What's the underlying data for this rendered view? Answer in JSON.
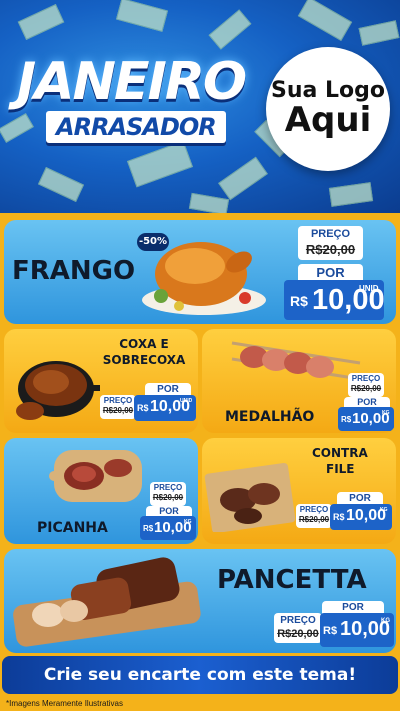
{
  "hero": {
    "title": "JANEIRO",
    "subtitle": "ARRASADOR",
    "logo_line1": "Sua Logo",
    "logo_line2": "Aqui"
  },
  "products": [
    {
      "name": "FRANGO",
      "discount": "-50%",
      "preco_label": "PREÇO",
      "old_price": "R$20,00",
      "por_label": "POR",
      "currency": "R$",
      "value": "10,00",
      "unit": "UNID"
    },
    {
      "name_line1": "COXA E",
      "name_line2": "SOBRECOXA",
      "preco_label": "PREÇO",
      "old_price": "R$20,00",
      "por_label": "POR",
      "currency": "R$",
      "value": "10,00",
      "unit": "UNID"
    },
    {
      "name": "MEDALHÃO",
      "preco_label": "PREÇO",
      "old_price": "R$20,00",
      "por_label": "POR",
      "currency": "R$",
      "value": "10,00",
      "unit": "KG"
    },
    {
      "name": "PICANHA",
      "preco_label": "PREÇO",
      "old_price": "R$20,00",
      "por_label": "POR",
      "currency": "R$",
      "value": "10,00",
      "unit": "KG"
    },
    {
      "name_line1": "CONTRA",
      "name_line2": "FILE",
      "preco_label": "PREÇO",
      "old_price": "R$20,00",
      "por_label": "POR",
      "currency": "R$",
      "value": "10,00",
      "unit": "KG"
    },
    {
      "name": "PANCETTA",
      "preco_label": "PREÇO",
      "old_price": "R$20,00",
      "por_label": "POR",
      "currency": "R$",
      "value": "10,00",
      "unit": "KG"
    }
  ],
  "footer": {
    "cta": "Crie seu encarte com este tema!",
    "disclaimer": "*Imagens Meramente Ilustrativas"
  },
  "colors": {
    "accent_blue": "#1d63c8",
    "panel_blue": "#2f95dd",
    "panel_yellow": "#f4a914",
    "hero_blue": "#1561c4"
  }
}
